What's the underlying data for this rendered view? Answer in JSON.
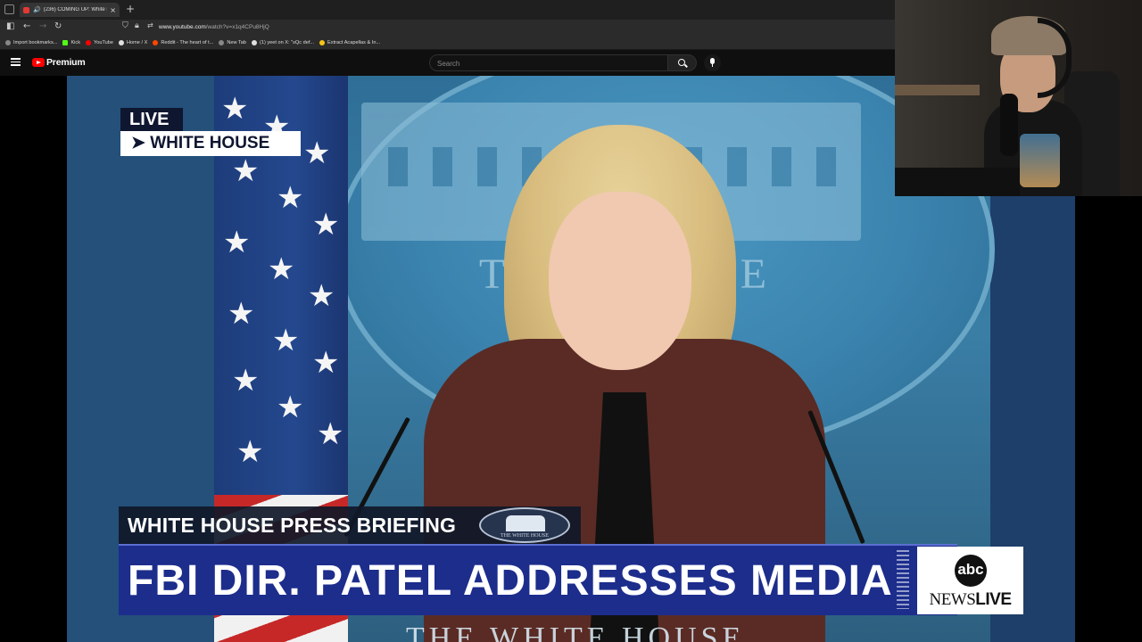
{
  "browser": {
    "tab_title": "(236) COMING UP: White H",
    "url_host": "www.youtube.com",
    "url_path": "/watch?v=x1q4CPu8HjQ",
    "bookmarks": [
      {
        "label": "Import bookmarks...",
        "color": "#9e9e9e"
      },
      {
        "label": "Kick",
        "color": "#53fc18"
      },
      {
        "label": "YouTube",
        "color": "#ff0000"
      },
      {
        "label": "Home / X",
        "color": "#e0e0e0"
      },
      {
        "label": "Reddit - The heart of t...",
        "color": "#ff4500"
      },
      {
        "label": "New Tab",
        "color": "#9e9e9e"
      },
      {
        "label": "(1) yeet on X: \"sQc def...",
        "color": "#e0e0e0"
      },
      {
        "label": "Extract Acapellas & In...",
        "color": "#f5c518"
      }
    ]
  },
  "youtube": {
    "brand": "Premium",
    "search_placeholder": "Search"
  },
  "video": {
    "live_label": "LIVE",
    "location_label": "➤ WHITE HOUSE",
    "lower_third_top": "WHITE HOUSE PRESS BRIEFING",
    "seal_caption": "THE WHITE HOUSE",
    "headline": "FBI DIR. PATEL ADDRESSES MEDIA",
    "network_logo": "abc",
    "network_news": "NEWS",
    "network_live": "LIVE",
    "backdrop_text": "THE W      OUSE",
    "podium_text": "THE WHITE HOUSE"
  },
  "colors": {
    "accent_red": "#ff0000",
    "abc_blue": "#1c2d8c"
  }
}
